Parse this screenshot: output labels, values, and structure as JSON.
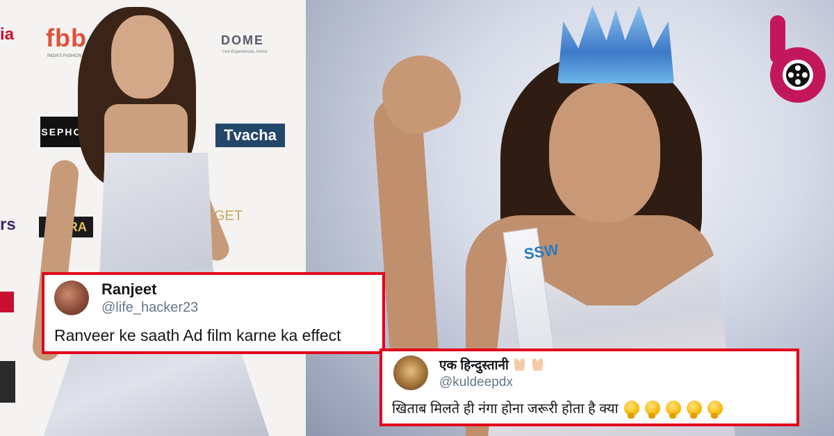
{
  "left_photo": {
    "backdrop_logos": {
      "fbb": "fbb",
      "fbb_sub": "INDIA'S FASHION HUB",
      "dome": "DOME",
      "dome_sub": "Live Experiences, Homs",
      "sephora": "SEPHORA",
      "tvacha": "Tvacha",
      "ultra": "ULTRA",
      "get": "GET",
      "partial_left_top": "ia",
      "partial_left_mid": "rs"
    }
  },
  "right_photo": {
    "sash_text": "SSW"
  },
  "brand_logo": {
    "letter": "b",
    "icon": "film-reel-icon",
    "color": "#c2185b"
  },
  "tweets": [
    {
      "name": "Ranjeet",
      "handle": "@life_hacker23",
      "text": "Ranveer ke saath Ad film karne ka effect"
    },
    {
      "name": "एक हिन्दुस्तानी",
      "handle": "@kuldeepdx",
      "text": "खिताब मिलते ही नंगा होना जरूरी होता है क्या",
      "name_emoji": "folded-hands-icon",
      "text_emoji": "thinking-face-icon",
      "text_emoji_count": 5
    }
  ],
  "colors": {
    "card_border": "#e3001b",
    "handle": "#657786",
    "text": "#14171a"
  }
}
